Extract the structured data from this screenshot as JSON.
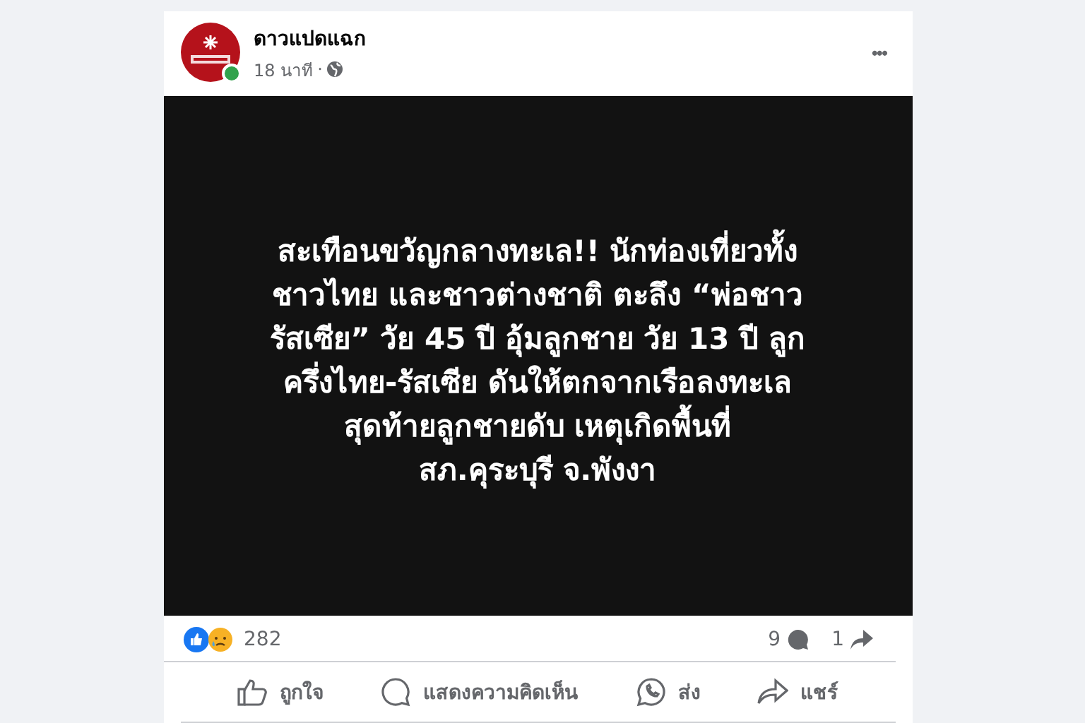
{
  "post": {
    "author": "ดาวแปดแฉก",
    "author_online": true,
    "time": "18 นาที",
    "time_separator": "·",
    "menu": "•••",
    "image_lines": [
      "สะเทือนขวัญกลางทะเล!! นักท่องเที่ยวทั้ง",
      "ชาวไทย และชาวต่างชาติ ตะลึง “พ่อชาว",
      "รัสเซีย” วัย 45 ปี อุ้มลูกชาย วัย 13 ปี ลูก",
      "ครึ่งไทย-รัสเซีย ดันให้ตกจากเรือลงทะเล",
      "สุดท้ายลูกชายดับ เหตุเกิดพื้นที่",
      "สภ.คุระบุรี จ.พังงา"
    ],
    "reactions": "282",
    "comments": "9",
    "shares": "1",
    "actions": [
      {
        "kind": "like",
        "label": "ถูกใจ"
      },
      {
        "kind": "comment",
        "label": "แสดงความคิดเห็น"
      },
      {
        "kind": "send",
        "label": "ส่ง"
      },
      {
        "kind": "share",
        "label": "แชร์"
      }
    ]
  }
}
